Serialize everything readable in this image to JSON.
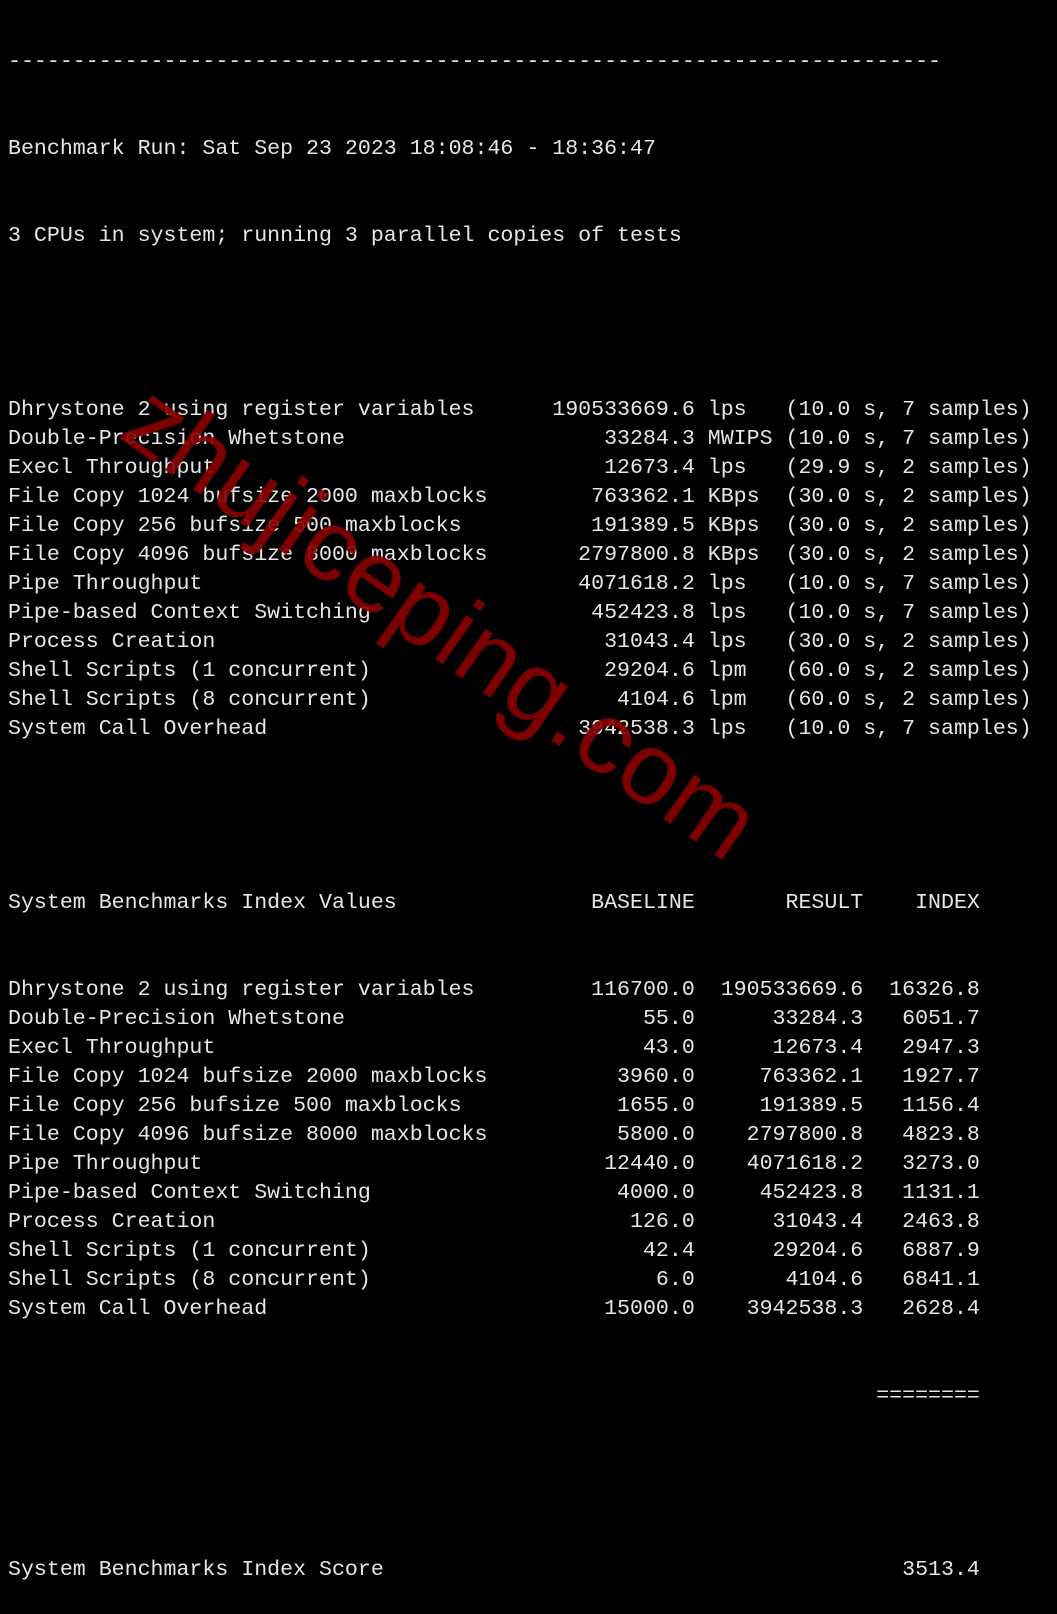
{
  "terminal": {
    "separator": "------------------------------------------------------------------------",
    "run_line": "Benchmark Run: Sat Sep 23 2023 18:08:46 - 18:36:47",
    "cpu_line": "3 CPUs in system; running 3 parallel copies of tests",
    "raw_results": [
      {
        "test": "Dhrystone 2 using register variables",
        "value": "190533669.6",
        "unit": "lps",
        "time": "10.0 s",
        "samples": "7 samples"
      },
      {
        "test": "Double-Precision Whetstone",
        "value": "33284.3",
        "unit": "MWIPS",
        "time": "10.0 s",
        "samples": "7 samples"
      },
      {
        "test": "Execl Throughput",
        "value": "12673.4",
        "unit": "lps",
        "time": "29.9 s",
        "samples": "2 samples"
      },
      {
        "test": "File Copy 1024 bufsize 2000 maxblocks",
        "value": "763362.1",
        "unit": "KBps",
        "time": "30.0 s",
        "samples": "2 samples"
      },
      {
        "test": "File Copy 256 bufsize 500 maxblocks",
        "value": "191389.5",
        "unit": "KBps",
        "time": "30.0 s",
        "samples": "2 samples"
      },
      {
        "test": "File Copy 4096 bufsize 8000 maxblocks",
        "value": "2797800.8",
        "unit": "KBps",
        "time": "30.0 s",
        "samples": "2 samples"
      },
      {
        "test": "Pipe Throughput",
        "value": "4071618.2",
        "unit": "lps",
        "time": "10.0 s",
        "samples": "7 samples"
      },
      {
        "test": "Pipe-based Context Switching",
        "value": "452423.8",
        "unit": "lps",
        "time": "10.0 s",
        "samples": "7 samples"
      },
      {
        "test": "Process Creation",
        "value": "31043.4",
        "unit": "lps",
        "time": "30.0 s",
        "samples": "2 samples"
      },
      {
        "test": "Shell Scripts (1 concurrent)",
        "value": "29204.6",
        "unit": "lpm",
        "time": "60.0 s",
        "samples": "2 samples"
      },
      {
        "test": "Shell Scripts (8 concurrent)",
        "value": "4104.6",
        "unit": "lpm",
        "time": "60.0 s",
        "samples": "2 samples"
      },
      {
        "test": "System Call Overhead",
        "value": "3942538.3",
        "unit": "lps",
        "time": "10.0 s",
        "samples": "7 samples"
      }
    ],
    "index_header": {
      "title": "System Benchmarks Index Values",
      "baseline": "BASELINE",
      "result": "RESULT",
      "index": "INDEX"
    },
    "index_rows": [
      {
        "test": "Dhrystone 2 using register variables",
        "baseline": "116700.0",
        "result": "190533669.6",
        "index": "16326.8"
      },
      {
        "test": "Double-Precision Whetstone",
        "baseline": "55.0",
        "result": "33284.3",
        "index": "6051.7"
      },
      {
        "test": "Execl Throughput",
        "baseline": "43.0",
        "result": "12673.4",
        "index": "2947.3"
      },
      {
        "test": "File Copy 1024 bufsize 2000 maxblocks",
        "baseline": "3960.0",
        "result": "763362.1",
        "index": "1927.7"
      },
      {
        "test": "File Copy 256 bufsize 500 maxblocks",
        "baseline": "1655.0",
        "result": "191389.5",
        "index": "1156.4"
      },
      {
        "test": "File Copy 4096 bufsize 8000 maxblocks",
        "baseline": "5800.0",
        "result": "2797800.8",
        "index": "4823.8"
      },
      {
        "test": "Pipe Throughput",
        "baseline": "12440.0",
        "result": "4071618.2",
        "index": "3273.0"
      },
      {
        "test": "Pipe-based Context Switching",
        "baseline": "4000.0",
        "result": "452423.8",
        "index": "1131.1"
      },
      {
        "test": "Process Creation",
        "baseline": "126.0",
        "result": "31043.4",
        "index": "2463.8"
      },
      {
        "test": "Shell Scripts (1 concurrent)",
        "baseline": "42.4",
        "result": "29204.6",
        "index": "6887.9"
      },
      {
        "test": "Shell Scripts (8 concurrent)",
        "baseline": "6.0",
        "result": "4104.6",
        "index": "6841.1"
      },
      {
        "test": "System Call Overhead",
        "baseline": "15000.0",
        "result": "3942538.3",
        "index": "2628.4"
      }
    ],
    "total_separator": "========",
    "score_label": "System Benchmarks Index Score",
    "score_value": "3513.4"
  },
  "watermark": {
    "text": "zhujiceping.com",
    "color": "#8b0000"
  }
}
